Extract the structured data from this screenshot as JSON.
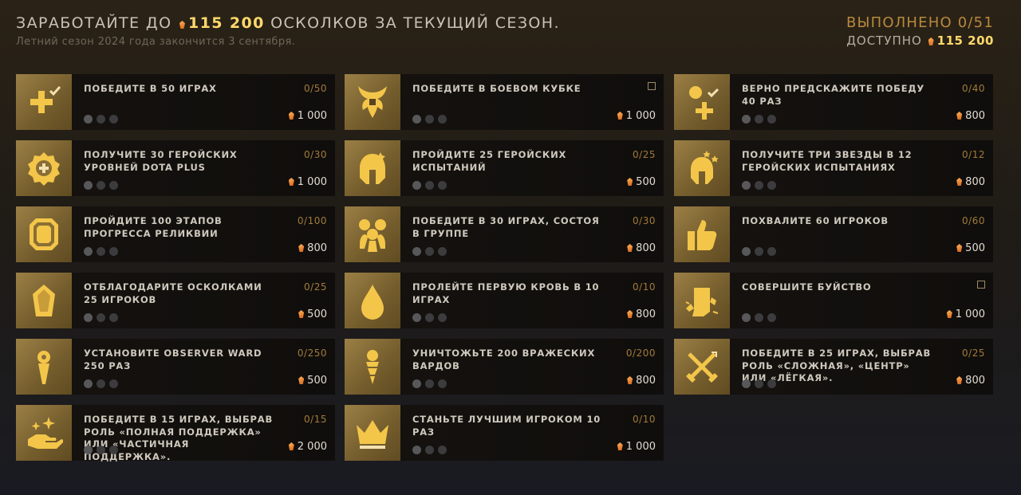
{
  "header": {
    "title_prefix": "ЗАРАБОТАЙТЕ ДО",
    "title_amount": "115 200",
    "title_suffix": "ОСКОЛКОВ ЗА ТЕКУЩИЙ СЕЗОН.",
    "subtitle": "Летний сезон 2024 года закончится 3 сентября.",
    "completed": "ВЫПОЛНЕНО 0/51",
    "available_label": "ДОСТУПНО",
    "available_amount": "115 200"
  },
  "colors": {
    "accent_gold": "#ffd96b",
    "tile": "#8a7040",
    "progress": "#a17a3a",
    "shard": "#e07a2a"
  },
  "quests": [
    {
      "title": "ПОБЕДИТЕ В 50 ИГРАХ",
      "progress": "0/50",
      "reward": "1 000",
      "icon": "plus-check-icon"
    },
    {
      "title": "ПОБЕДИТЕ В БОЕВОМ КУБКЕ",
      "progress": "",
      "reward": "1 000",
      "icon": "battle-cup-icon"
    },
    {
      "title": "ВЕРНО ПРЕДСКАЖИТЕ ПОБЕДУ 40 РАЗ",
      "progress": "0/40",
      "reward": "800",
      "icon": "prediction-icon"
    },
    {
      "title": "ПОЛУЧИТЕ 30 ГЕРОЙСКИХ УРОВНЕЙ DOTA PLUS",
      "progress": "0/30",
      "reward": "1 000",
      "icon": "dota-plus-icon"
    },
    {
      "title": "ПРОЙДИТЕ 25 ГЕРОЙСКИХ ИСПЫТАНИЙ",
      "progress": "0/25",
      "reward": "500",
      "icon": "hero-helmet-icon"
    },
    {
      "title": "ПОЛУЧИТЕ ТРИ ЗВЕЗДЫ В 12 ГЕРОЙСКИХ ИСПЫТАНИЯХ",
      "progress": "0/12",
      "reward": "800",
      "icon": "hero-helmet-stars-icon"
    },
    {
      "title": "ПРОЙДИТЕ 100 ЭТАПОВ ПРОГРЕССА РЕЛИКВИИ",
      "progress": "0/100",
      "reward": "800",
      "icon": "relic-icon"
    },
    {
      "title": "ПОБЕДИТЕ В 30 ИГРАХ, СОСТОЯ В ГРУППЕ",
      "progress": "0/30",
      "reward": "800",
      "icon": "party-icon"
    },
    {
      "title": "ПОХВАЛИТЕ 60 ИГРОКОВ",
      "progress": "0/60",
      "reward": "500",
      "icon": "thumbs-up-icon"
    },
    {
      "title": "ОТБЛАГОДАРИТЕ ОСКОЛКАМИ 25 ИГРОКОВ",
      "progress": "0/25",
      "reward": "500",
      "icon": "shard-tip-icon"
    },
    {
      "title": "ПРОЛЕЙТЕ ПЕРВУЮ КРОВЬ В 10 ИГРАХ",
      "progress": "0/10",
      "reward": "800",
      "icon": "blood-drop-icon"
    },
    {
      "title": "СОВЕРШИТЕ БУЙСТВО",
      "progress": "",
      "reward": "1 000",
      "icon": "rampage-icon"
    },
    {
      "title": "УСТАНОВИТЕ OBSERVER WARD 250 РАЗ",
      "progress": "0/250",
      "reward": "500",
      "icon": "observer-ward-icon"
    },
    {
      "title": "УНИЧТОЖЬТЕ 200 ВРАЖЕСКИХ ВАРДОВ",
      "progress": "0/200",
      "reward": "800",
      "icon": "deward-icon"
    },
    {
      "title": "ПОБЕДИТЕ В 25 ИГРАХ, ВЫБРАВ РОЛЬ «СЛОЖНАЯ», «ЦЕНТР» ИЛИ «ЛЁГКАЯ».",
      "progress": "0/25",
      "reward": "800",
      "icon": "crossed-swords-icon"
    },
    {
      "title": "ПОБЕДИТЕ В 15 ИГРАХ, ВЫБРАВ РОЛЬ «ПОЛНАЯ ПОДДЕРЖКА» ИЛИ «ЧАСТИЧНАЯ ПОДДЕРЖКА».",
      "progress": "0/15",
      "reward": "2 000",
      "icon": "support-hand-icon"
    },
    {
      "title": "СТАНЬТЕ ЛУЧШИМ ИГРОКОМ 10 РАЗ",
      "progress": "0/10",
      "reward": "1 000",
      "icon": "crown-icon"
    }
  ]
}
